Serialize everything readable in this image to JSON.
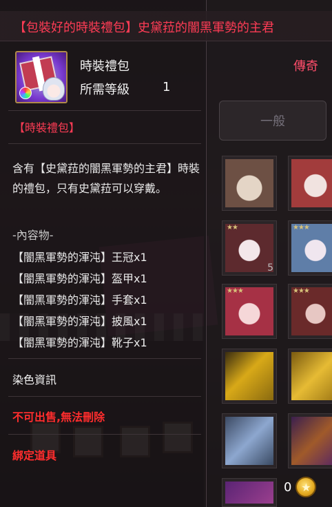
{
  "tooltip": {
    "title": "【包裝好的時裝禮包】史黛菈的闇黑軍勢的主君",
    "item_type": "時裝禮包",
    "rarity": "傳奇",
    "level_label": "所需等級",
    "level_value": "1",
    "category": "【時裝禮包】",
    "description": "含有【史黛菈的闇黑軍勢的主君】時裝的禮包，只有史黛菈可以穿戴。",
    "contents_title": "-內容物-",
    "contents": [
      "【闇黑軍勢的渾沌】王冠x1",
      "【闇黑軍勢的渾沌】盔甲x1",
      "【闇黑軍勢的渾沌】手套x1",
      "【闇黑軍勢的渾沌】披風x1",
      "【闇黑軍勢的渾沌】靴子x1"
    ],
    "dye_info": "染色資訊",
    "no_sell": "不可出售,無法刪除",
    "bound": "綁定道具"
  },
  "inventory": {
    "tab_label": "一般",
    "slot_quantity": "5",
    "currency_value": "0"
  },
  "colors": {
    "title_red": "#ff3c55",
    "warning_red": "#ff2d2d",
    "rarity_pink": "#ff4d6a"
  },
  "icons": {
    "item": "fashion-gift-box-icon",
    "coin": "gold-coin-icon"
  }
}
